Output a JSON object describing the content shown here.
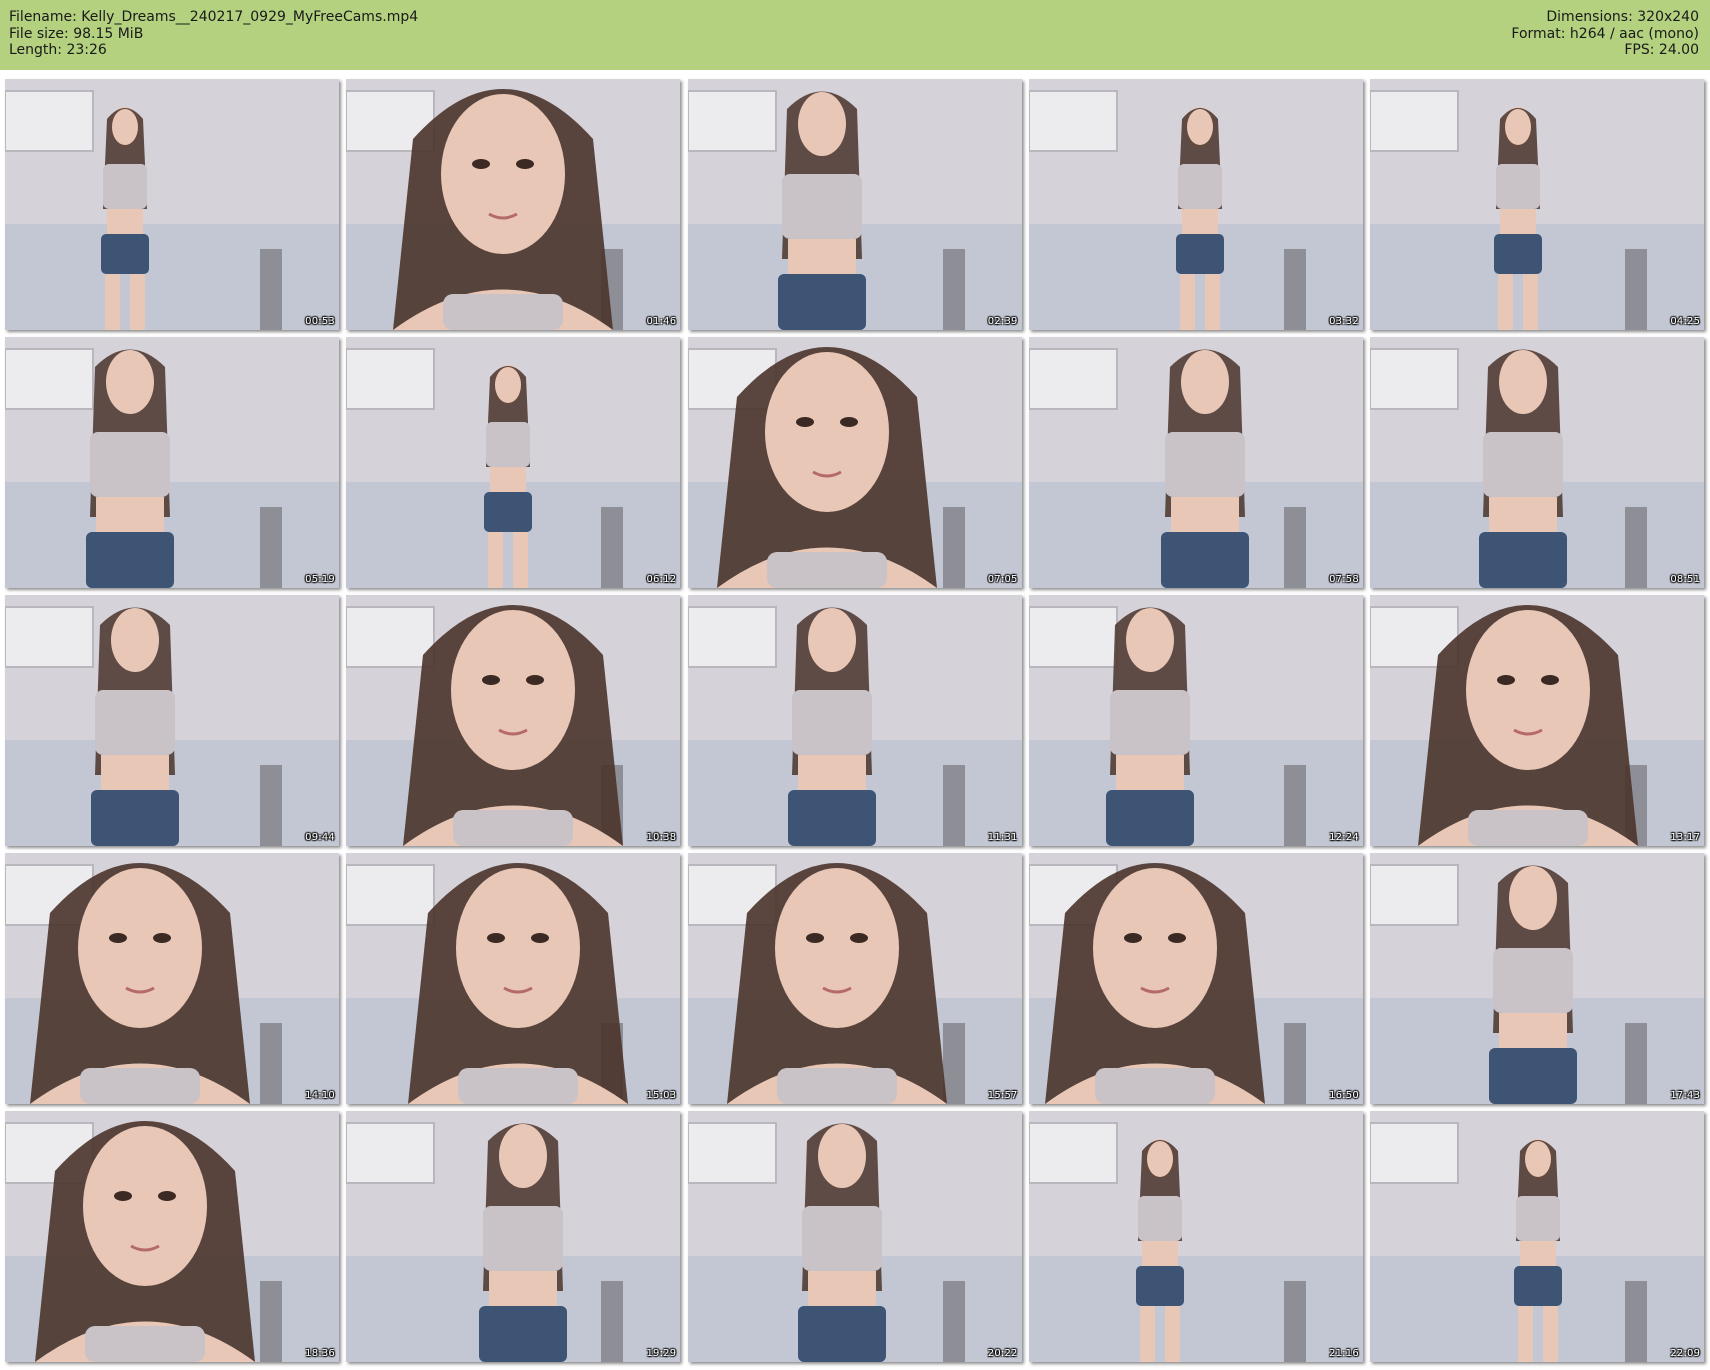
{
  "header": {
    "filename_line": "Filename: Kelly_Dreams__240217_0929_MyFreeCams.mp4",
    "filesize_line": "File size: 98.15 MiB",
    "length_line": "Length: 23:26",
    "dimensions_line": "Dimensions: 320x240",
    "format_line": "Format: h264 / aac (mono)",
    "fps_line": "FPS: 24.00"
  },
  "colors": {
    "header_bg": "#b3d17f",
    "page_bg": "#ffffff"
  },
  "thumbnails": [
    {
      "timestamp": "00:53",
      "shot": "full"
    },
    {
      "timestamp": "01:46",
      "shot": "close"
    },
    {
      "timestamp": "02:39",
      "shot": "mid"
    },
    {
      "timestamp": "03:32",
      "shot": "full"
    },
    {
      "timestamp": "04:25",
      "shot": "full"
    },
    {
      "timestamp": "05:19",
      "shot": "mid"
    },
    {
      "timestamp": "06:12",
      "shot": "full"
    },
    {
      "timestamp": "07:05",
      "shot": "close"
    },
    {
      "timestamp": "07:58",
      "shot": "mid"
    },
    {
      "timestamp": "08:51",
      "shot": "mid"
    },
    {
      "timestamp": "09:44",
      "shot": "mid"
    },
    {
      "timestamp": "10:38",
      "shot": "close"
    },
    {
      "timestamp": "11:31",
      "shot": "mid"
    },
    {
      "timestamp": "12:24",
      "shot": "mid"
    },
    {
      "timestamp": "13:17",
      "shot": "close"
    },
    {
      "timestamp": "14:10",
      "shot": "close"
    },
    {
      "timestamp": "15:03",
      "shot": "close"
    },
    {
      "timestamp": "15:57",
      "shot": "close"
    },
    {
      "timestamp": "16:50",
      "shot": "close"
    },
    {
      "timestamp": "17:43",
      "shot": "mid"
    },
    {
      "timestamp": "18:36",
      "shot": "close"
    },
    {
      "timestamp": "19:29",
      "shot": "mid"
    },
    {
      "timestamp": "20:22",
      "shot": "mid"
    },
    {
      "timestamp": "21:16",
      "shot": "full"
    },
    {
      "timestamp": "22:09",
      "shot": "full"
    }
  ]
}
